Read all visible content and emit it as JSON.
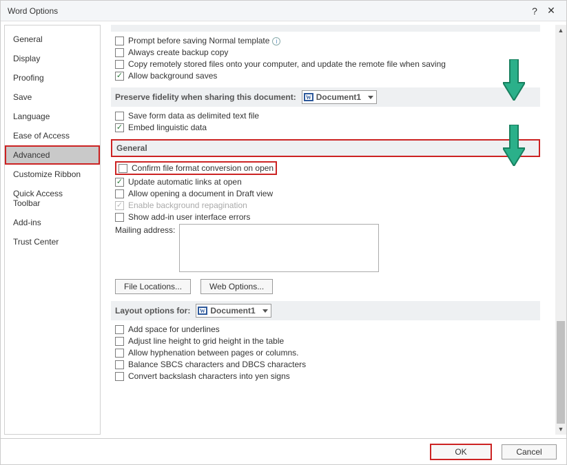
{
  "title": "Word Options",
  "sidebar": {
    "items": [
      {
        "label": "General"
      },
      {
        "label": "Display"
      },
      {
        "label": "Proofing"
      },
      {
        "label": "Save"
      },
      {
        "label": "Language"
      },
      {
        "label": "Ease of Access"
      },
      {
        "label": "Advanced"
      },
      {
        "label": "Customize Ribbon"
      },
      {
        "label": "Quick Access Toolbar"
      },
      {
        "label": "Add-ins"
      },
      {
        "label": "Trust Center"
      }
    ],
    "selected": "Advanced"
  },
  "save_group": {
    "prompt_before_saving": "Prompt before saving Normal template",
    "always_backup": "Always create backup copy",
    "copy_remote": "Copy remotely stored files onto your computer, and update the remote file when saving",
    "allow_bg_saves": "Allow background saves"
  },
  "fidelity": {
    "header": "Preserve fidelity when sharing this document:",
    "doc": "Document1",
    "save_form_data": "Save form data as delimited text file",
    "embed_linguistic": "Embed linguistic data"
  },
  "general": {
    "header": "General",
    "confirm_convert": "Confirm file format conversion on open",
    "update_links": "Update automatic links at open",
    "allow_draft": "Allow opening a document in Draft view",
    "enable_repag": "Enable background repagination",
    "show_addin_errors": "Show add-in user interface errors",
    "mailing_label": "Mailing address:",
    "file_locations": "File Locations...",
    "web_options": "Web Options..."
  },
  "layout": {
    "header": "Layout options for:",
    "doc": "Document1",
    "add_space": "Add space for underlines",
    "adjust_line": "Adjust line height to grid height in the table",
    "allow_hyphen": "Allow hyphenation between pages or columns.",
    "balance_sbcs": "Balance SBCS characters and DBCS characters",
    "convert_backslash": "Convert backslash characters into yen signs"
  },
  "footer": {
    "ok": "OK",
    "cancel": "Cancel"
  }
}
